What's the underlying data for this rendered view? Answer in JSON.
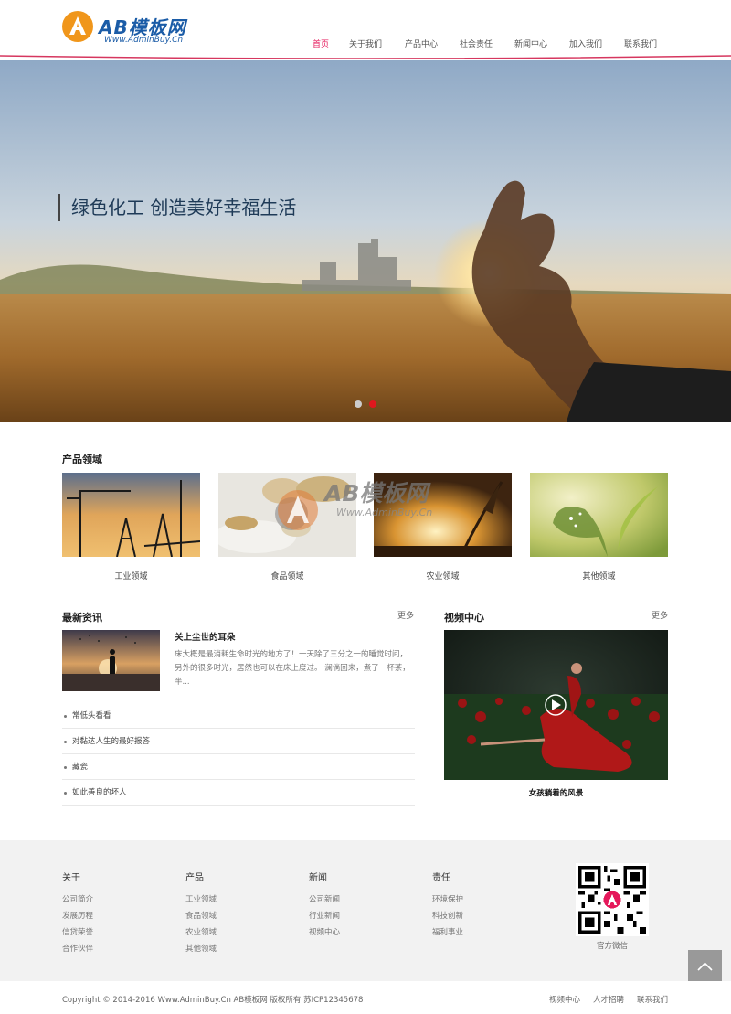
{
  "header": {
    "logo_text": "AB模板网",
    "logo_sub": "Www.AdminBuy.Cn",
    "nav": [
      "首页",
      "关于我们",
      "产品中心",
      "社会责任",
      "新闻中心",
      "加入我们",
      "联系我们"
    ],
    "active_index": 0,
    "accent_color": "#e5185b"
  },
  "hero": {
    "caption": "绿色化工 创造美好幸福生活",
    "slides": 2,
    "active_slide": 1
  },
  "products": {
    "title": "产品领域",
    "items": [
      "工业领域",
      "食品领域",
      "农业领域",
      "其他领域"
    ],
    "watermark_text": "AB模板网",
    "watermark_sub": "Www.AdminBuy.Cn"
  },
  "news": {
    "title": "最新资讯",
    "more": "更多",
    "featured_title": "关上尘世的耳朵",
    "featured_desc": "床大概是最消耗生命时光的地方了！一天除了三分之一的睡觉时间，另外的很多时光，居然也可以在床上度过。 澜倘回来，煮了一杯茶，半...",
    "items": [
      "常低头看看",
      "对黏达人生的最好报答",
      "藏瓷",
      "如此善良的坏人"
    ]
  },
  "video": {
    "title": "视频中心",
    "more": "更多",
    "caption": "女孩躺着的风景"
  },
  "footer": {
    "columns": [
      {
        "title": "关于",
        "links": [
          "公司简介",
          "发展历程",
          "信贷荣誉",
          "合作伙伴"
        ]
      },
      {
        "title": "产品",
        "links": [
          "工业领域",
          "食品领域",
          "农业领域",
          "其他领域"
        ]
      },
      {
        "title": "新闻",
        "links": [
          "公司新闻",
          "行业新闻",
          "视频中心"
        ]
      },
      {
        "title": "责任",
        "links": [
          "环境保护",
          "科技创新",
          "福利事业"
        ]
      }
    ],
    "qr_label": "官方微信",
    "copyright": "Copyright © 2014-2016 Www.AdminBuy.Cn AB模板网 版权所有   苏ICP12345678",
    "bottom_links": [
      "视频中心",
      "人才招聘",
      "联系我们"
    ]
  }
}
